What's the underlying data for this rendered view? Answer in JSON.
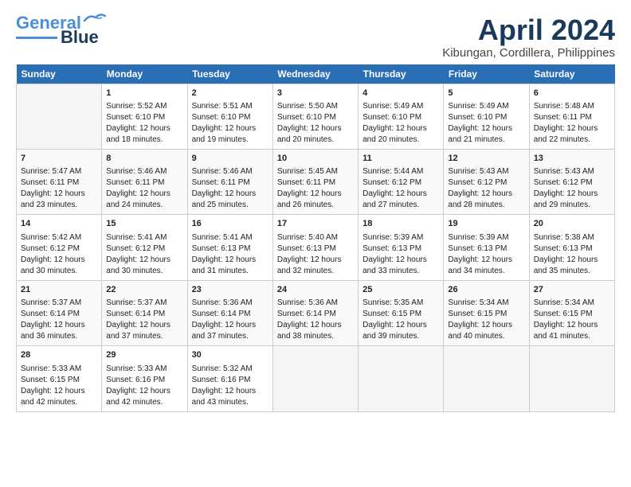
{
  "logo": {
    "line1": "General",
    "line2": "Blue"
  },
  "title": "April 2024",
  "subtitle": "Kibungan, Cordillera, Philippines",
  "days_of_week": [
    "Sunday",
    "Monday",
    "Tuesday",
    "Wednesday",
    "Thursday",
    "Friday",
    "Saturday"
  ],
  "weeks": [
    [
      {
        "day": "",
        "content": ""
      },
      {
        "day": "1",
        "content": "Sunrise: 5:52 AM\nSunset: 6:10 PM\nDaylight: 12 hours\nand 18 minutes."
      },
      {
        "day": "2",
        "content": "Sunrise: 5:51 AM\nSunset: 6:10 PM\nDaylight: 12 hours\nand 19 minutes."
      },
      {
        "day": "3",
        "content": "Sunrise: 5:50 AM\nSunset: 6:10 PM\nDaylight: 12 hours\nand 20 minutes."
      },
      {
        "day": "4",
        "content": "Sunrise: 5:49 AM\nSunset: 6:10 PM\nDaylight: 12 hours\nand 20 minutes."
      },
      {
        "day": "5",
        "content": "Sunrise: 5:49 AM\nSunset: 6:10 PM\nDaylight: 12 hours\nand 21 minutes."
      },
      {
        "day": "6",
        "content": "Sunrise: 5:48 AM\nSunset: 6:11 PM\nDaylight: 12 hours\nand 22 minutes."
      }
    ],
    [
      {
        "day": "7",
        "content": "Sunrise: 5:47 AM\nSunset: 6:11 PM\nDaylight: 12 hours\nand 23 minutes."
      },
      {
        "day": "8",
        "content": "Sunrise: 5:46 AM\nSunset: 6:11 PM\nDaylight: 12 hours\nand 24 minutes."
      },
      {
        "day": "9",
        "content": "Sunrise: 5:46 AM\nSunset: 6:11 PM\nDaylight: 12 hours\nand 25 minutes."
      },
      {
        "day": "10",
        "content": "Sunrise: 5:45 AM\nSunset: 6:11 PM\nDaylight: 12 hours\nand 26 minutes."
      },
      {
        "day": "11",
        "content": "Sunrise: 5:44 AM\nSunset: 6:12 PM\nDaylight: 12 hours\nand 27 minutes."
      },
      {
        "day": "12",
        "content": "Sunrise: 5:43 AM\nSunset: 6:12 PM\nDaylight: 12 hours\nand 28 minutes."
      },
      {
        "day": "13",
        "content": "Sunrise: 5:43 AM\nSunset: 6:12 PM\nDaylight: 12 hours\nand 29 minutes."
      }
    ],
    [
      {
        "day": "14",
        "content": "Sunrise: 5:42 AM\nSunset: 6:12 PM\nDaylight: 12 hours\nand 30 minutes."
      },
      {
        "day": "15",
        "content": "Sunrise: 5:41 AM\nSunset: 6:12 PM\nDaylight: 12 hours\nand 30 minutes."
      },
      {
        "day": "16",
        "content": "Sunrise: 5:41 AM\nSunset: 6:13 PM\nDaylight: 12 hours\nand 31 minutes."
      },
      {
        "day": "17",
        "content": "Sunrise: 5:40 AM\nSunset: 6:13 PM\nDaylight: 12 hours\nand 32 minutes."
      },
      {
        "day": "18",
        "content": "Sunrise: 5:39 AM\nSunset: 6:13 PM\nDaylight: 12 hours\nand 33 minutes."
      },
      {
        "day": "19",
        "content": "Sunrise: 5:39 AM\nSunset: 6:13 PM\nDaylight: 12 hours\nand 34 minutes."
      },
      {
        "day": "20",
        "content": "Sunrise: 5:38 AM\nSunset: 6:13 PM\nDaylight: 12 hours\nand 35 minutes."
      }
    ],
    [
      {
        "day": "21",
        "content": "Sunrise: 5:37 AM\nSunset: 6:14 PM\nDaylight: 12 hours\nand 36 minutes."
      },
      {
        "day": "22",
        "content": "Sunrise: 5:37 AM\nSunset: 6:14 PM\nDaylight: 12 hours\nand 37 minutes."
      },
      {
        "day": "23",
        "content": "Sunrise: 5:36 AM\nSunset: 6:14 PM\nDaylight: 12 hours\nand 37 minutes."
      },
      {
        "day": "24",
        "content": "Sunrise: 5:36 AM\nSunset: 6:14 PM\nDaylight: 12 hours\nand 38 minutes."
      },
      {
        "day": "25",
        "content": "Sunrise: 5:35 AM\nSunset: 6:15 PM\nDaylight: 12 hours\nand 39 minutes."
      },
      {
        "day": "26",
        "content": "Sunrise: 5:34 AM\nSunset: 6:15 PM\nDaylight: 12 hours\nand 40 minutes."
      },
      {
        "day": "27",
        "content": "Sunrise: 5:34 AM\nSunset: 6:15 PM\nDaylight: 12 hours\nand 41 minutes."
      }
    ],
    [
      {
        "day": "28",
        "content": "Sunrise: 5:33 AM\nSunset: 6:15 PM\nDaylight: 12 hours\nand 42 minutes."
      },
      {
        "day": "29",
        "content": "Sunrise: 5:33 AM\nSunset: 6:16 PM\nDaylight: 12 hours\nand 42 minutes."
      },
      {
        "day": "30",
        "content": "Sunrise: 5:32 AM\nSunset: 6:16 PM\nDaylight: 12 hours\nand 43 minutes."
      },
      {
        "day": "",
        "content": ""
      },
      {
        "day": "",
        "content": ""
      },
      {
        "day": "",
        "content": ""
      },
      {
        "day": "",
        "content": ""
      }
    ]
  ]
}
